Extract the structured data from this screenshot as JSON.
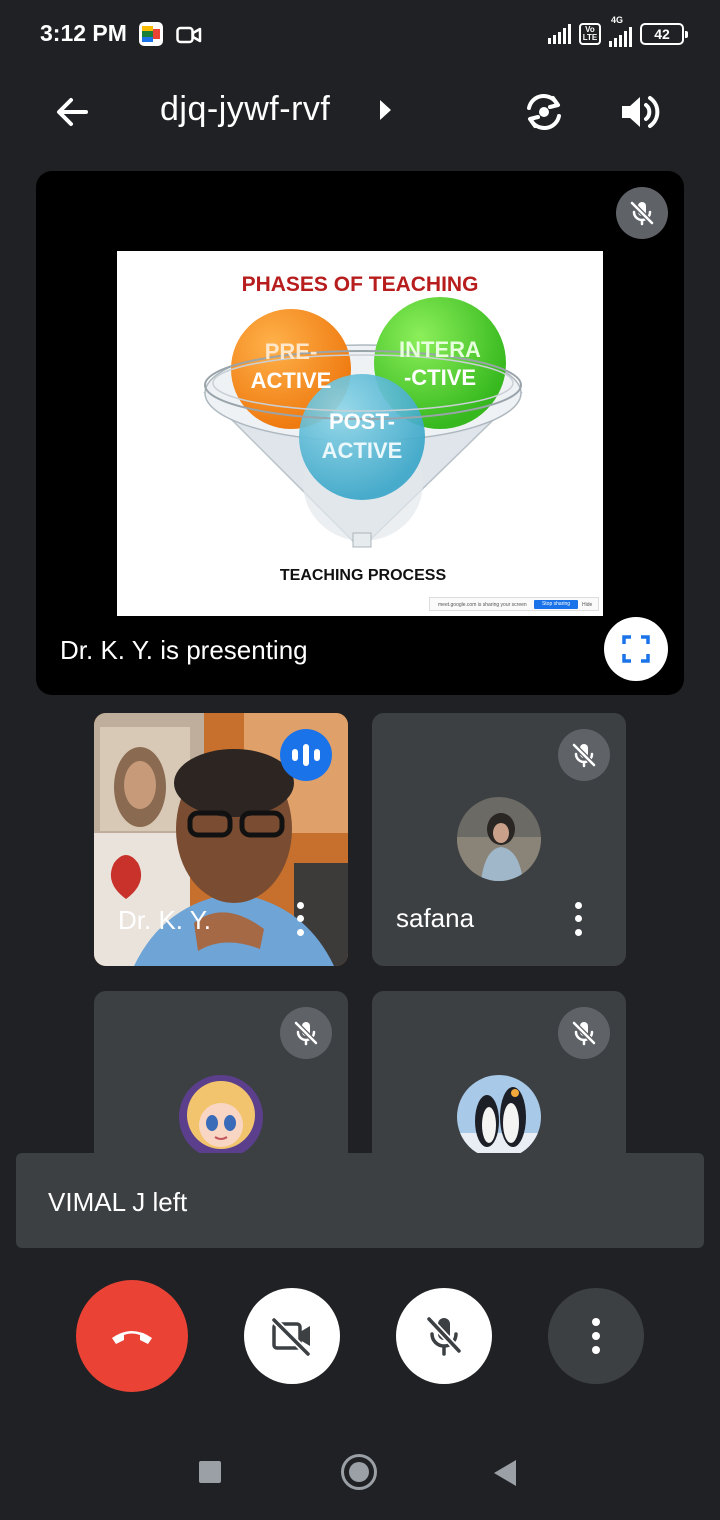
{
  "status_bar": {
    "time": "3:12 PM",
    "network_type": "4G",
    "volte_label": "Vo LTE",
    "battery": "42"
  },
  "header": {
    "meeting_code": "djq-jywf-rvf"
  },
  "presentation": {
    "slide_title": "PHASES OF TEACHING",
    "slide_caption": "TEACHING PROCESS",
    "circles": {
      "pre_line1": "PRE-",
      "pre_line2": "ACTIVE",
      "inter_line1": "INTERA",
      "inter_line2": "-CTIVE",
      "post_line1": "POST-",
      "post_line2": "ACTIVE"
    },
    "share_bar": {
      "text": "meet.google.com is sharing your screen",
      "stop_label": "Stop sharing",
      "hide_label": "Hide"
    },
    "presenting_text": "Dr. K. Y. is presenting"
  },
  "participants": [
    {
      "name": "Dr. K. Y.",
      "speaking": true,
      "muted": false
    },
    {
      "name": "safana",
      "speaking": false,
      "muted": true
    },
    {
      "name": "",
      "speaking": false,
      "muted": true
    },
    {
      "name": "",
      "speaking": false,
      "muted": true
    }
  ],
  "toast": {
    "message": "VIMAL J left"
  },
  "colors": {
    "background": "#202124",
    "tile": "#3c4043",
    "end_call": "#ea4335",
    "accent": "#1a73e8",
    "mute_badge": "#5f6368"
  }
}
